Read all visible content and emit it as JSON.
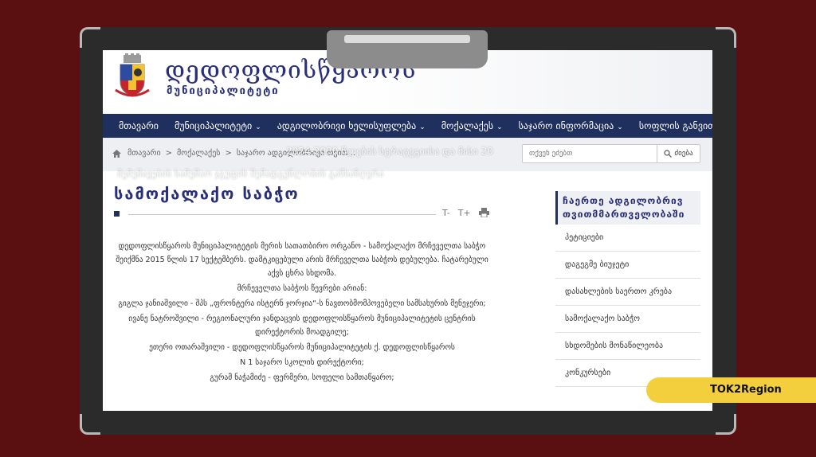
{
  "brand": {
    "title": "დედოფლისწყაროს",
    "subtitle": "მუნიციპალიტეტი"
  },
  "nav": {
    "items": [
      {
        "label": "მთავარი",
        "chevron": false
      },
      {
        "label": "მუნიციპალიტეტი",
        "chevron": true
      },
      {
        "label": "ადგილობრივი ხელისუფლება",
        "chevron": true
      },
      {
        "label": "მოქალაქეს",
        "chevron": true
      },
      {
        "label": "საჯარო ინფორმაცია",
        "chevron": true
      },
      {
        "label": "სოფლის განვითარება",
        "chevron": false
      }
    ]
  },
  "breadcrumb": {
    "items": [
      "მთავარი",
      "მოქალაქეს",
      "საჯარო ადგილობრივი თვით..."
    ],
    "separator": ">",
    "overlay_line1": "2024-2030 წლების სტრატეგიისა და მისი 20",
    "overlay_line2": "შემუშავების სამუშაო ჯგუფის შემადგენლობის განსაზღვრა"
  },
  "search": {
    "placeholder": "თქვენ ეძებთ",
    "button_label": "ძიება"
  },
  "main": {
    "title": "სამოქალაქო საბჭო",
    "tools": {
      "decrease": "T-",
      "increase": "T+"
    },
    "paragraphs": [
      "დედოფლისწყაროს მუნიციპალიტეტის მერის სათათბირო ორგანო - სამოქალაქო მრჩეველთა საბჭო შეიქმნა 2015 წლის 17 სექტემბერს. დამტკიცებული არის მრჩეველთა საბჭოს დებულება. ჩატარებული აქვს ცხრა სხდომა.",
      "მრჩეველთა საბჭოს წევრები არიან:",
      "გიგლა ჯანიაშვილი - შპს „ფრონტერა ისტერნ ჯორჯია“-ს ნავთობმომპოვებელი სამსახურის მენეჯერი;",
      "ივანე ნატროშვილი - რეგიონალური ჯანდაცვის დედოფლისწყაროს მუნიციპალიტეტის ცენტრის დირექტორის მოადგილე;",
      "ეთერი ოთარაშვილი - დედოფლისწყაროს მუნიციპალიტეტის ქ. დედოფლისწყაროს",
      "N 1 საჯარო სკოლის დირექტორი;",
      "გურამ ნაჭამიძე - ფერმერი, სოფელი სამთაწყარო;"
    ]
  },
  "sidebar": {
    "heading": "ჩაერთე ადგილობრივ თვითმმართველობაში",
    "items": [
      "პეტიციები",
      "დაგეგმე ბიუჯეტი",
      "დასახლების საერთო კრება",
      "სამოქალაქო საბჭო",
      "სხდომების მონაწილეობა",
      "კონკურსები"
    ]
  },
  "badge": {
    "text": "TOK2Region"
  },
  "colors": {
    "navy": "#1f2f5e",
    "brand_blue": "#2a2f7a",
    "background": "#5a1010",
    "badge": "#f3cf3e"
  }
}
